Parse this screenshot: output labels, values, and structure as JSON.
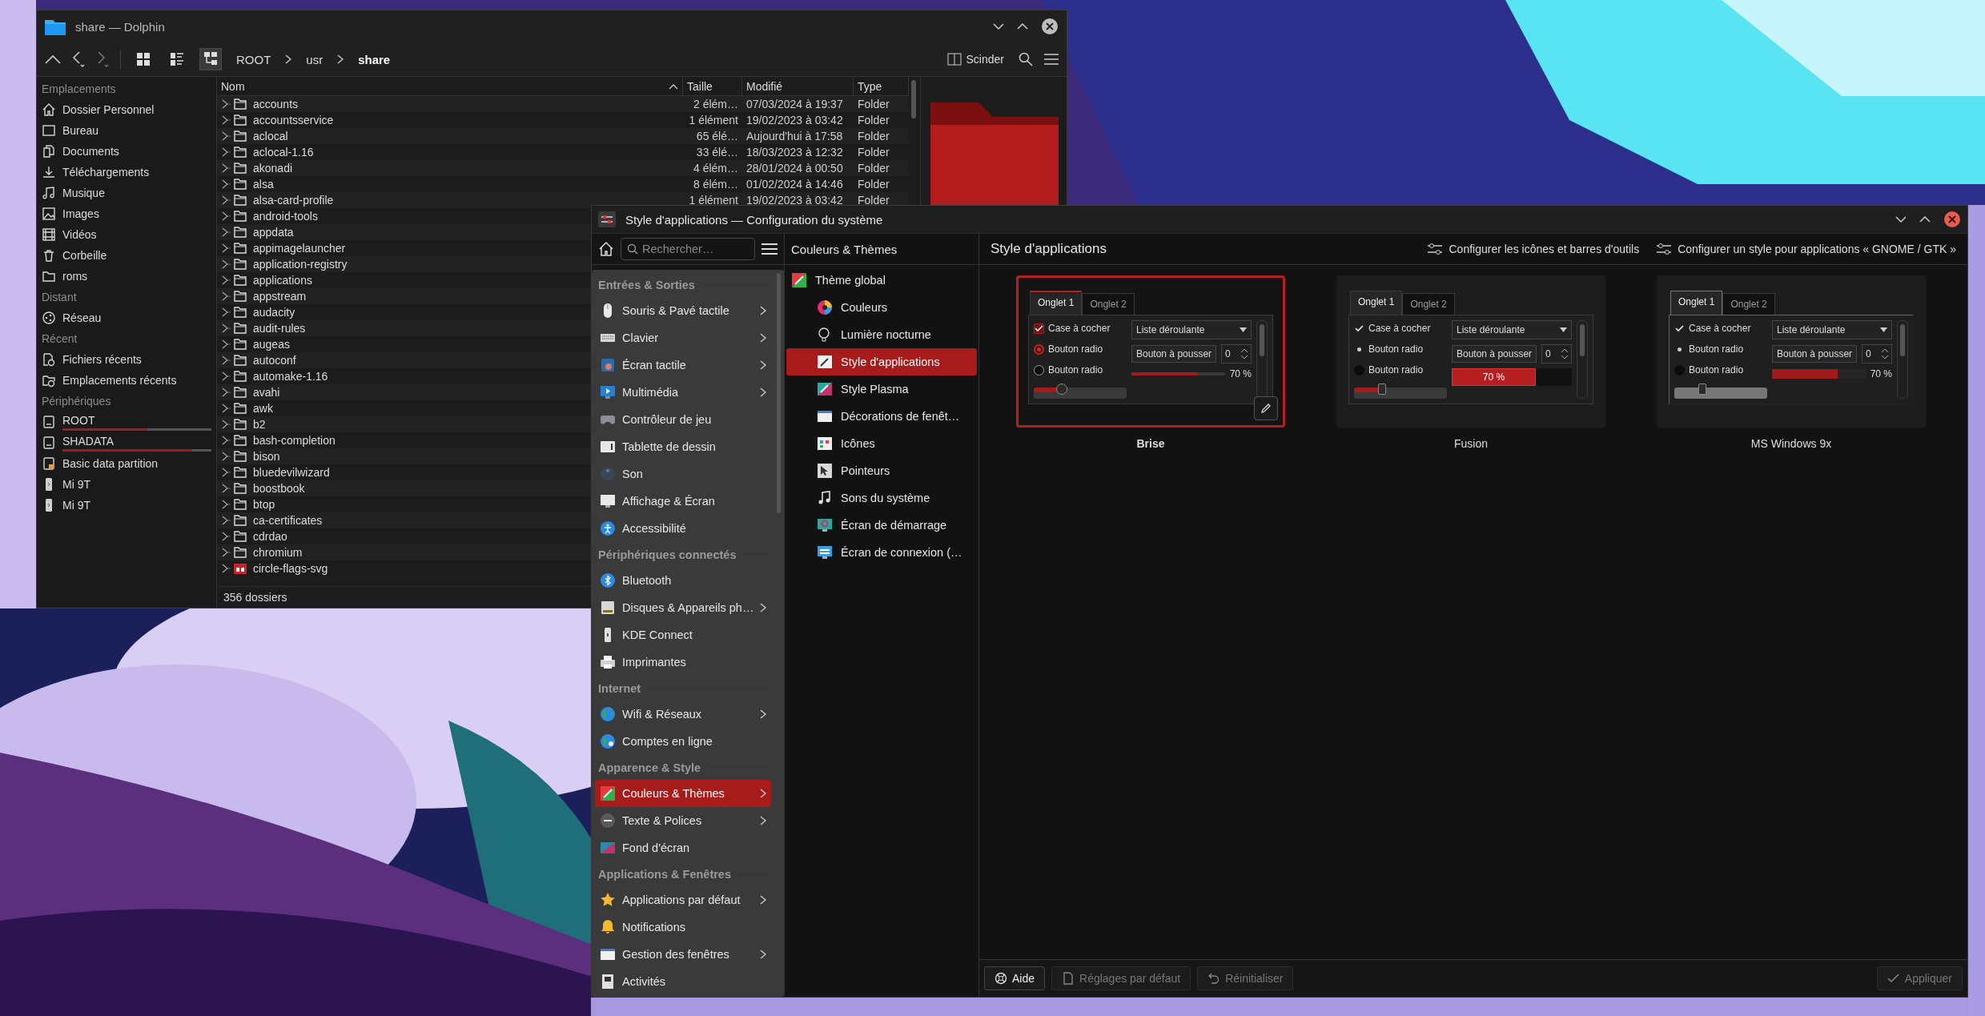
{
  "dolphin": {
    "title": "share — Dolphin",
    "view_modes": [
      {
        "selected": false
      },
      {
        "selected": false
      },
      {
        "selected": true
      }
    ],
    "breadcrumb": [
      {
        "label": "ROOT",
        "current": false
      },
      {
        "label": "usr",
        "current": false
      },
      {
        "label": "share",
        "current": true
      }
    ],
    "split_button": "Scinder",
    "places": [
      {
        "heading": "Emplacements",
        "items": [
          {
            "label": "Dossier Personnel"
          },
          {
            "label": "Bureau"
          },
          {
            "label": "Documents"
          },
          {
            "label": "Téléchargements"
          },
          {
            "label": "Musique"
          },
          {
            "label": "Images"
          },
          {
            "label": "Vidéos"
          },
          {
            "label": "Corbeille"
          },
          {
            "label": "roms"
          }
        ]
      },
      {
        "heading": "Distant",
        "items": [
          {
            "label": "Réseau"
          }
        ]
      },
      {
        "heading": "Récent",
        "items": [
          {
            "label": "Fichiers récents"
          },
          {
            "label": "Emplacements récents"
          }
        ]
      },
      {
        "heading": "Périphériques",
        "items": [
          {
            "label": "ROOT",
            "level": 0.57
          },
          {
            "label": "SHADATA",
            "level": 0.87
          },
          {
            "label": "Basic data partition"
          },
          {
            "label": "Mi 9T"
          },
          {
            "label": "Mi 9T"
          }
        ]
      }
    ],
    "columns": [
      "Nom",
      "Taille",
      "Modifié",
      "Type"
    ],
    "rows": [
      {
        "name": "accounts",
        "kind": "folder",
        "size": "2 élém…",
        "modified": "07/03/2024 à 19:37",
        "type": "Folder"
      },
      {
        "name": "accountsservice",
        "kind": "folder",
        "size": "1 élément",
        "modified": "19/02/2023 à 03:42",
        "type": "Folder"
      },
      {
        "name": "aclocal",
        "kind": "folder",
        "size": "65 élé…",
        "modified": "Aujourd'hui à 17:58",
        "type": "Folder"
      },
      {
        "name": "aclocal-1.16",
        "kind": "folder",
        "size": "33 élé…",
        "modified": "18/03/2023 à 12:32",
        "type": "Folder"
      },
      {
        "name": "akonadi",
        "kind": "folder",
        "size": "4 élém…",
        "modified": "28/01/2024 à 00:50",
        "type": "Folder"
      },
      {
        "name": "alsa",
        "kind": "folder",
        "size": "8 élém…",
        "modified": "01/02/2024 à 14:46",
        "type": "Folder"
      },
      {
        "name": "alsa-card-profile",
        "kind": "folder",
        "size": "1 élément",
        "modified": "19/02/2023 à 03:42",
        "type": "Folder"
      },
      {
        "name": "android-tools",
        "kind": "folder"
      },
      {
        "name": "appdata",
        "kind": "folder"
      },
      {
        "name": "appimagelauncher",
        "kind": "folder"
      },
      {
        "name": "application-registry",
        "kind": "folder"
      },
      {
        "name": "applications",
        "kind": "folder"
      },
      {
        "name": "appstream",
        "kind": "folder"
      },
      {
        "name": "audacity",
        "kind": "folder"
      },
      {
        "name": "audit-rules",
        "kind": "folder"
      },
      {
        "name": "augeas",
        "kind": "folder"
      },
      {
        "name": "autoconf",
        "kind": "folder"
      },
      {
        "name": "automake-1.16",
        "kind": "folder"
      },
      {
        "name": "avahi",
        "kind": "folder"
      },
      {
        "name": "awk",
        "kind": "folder"
      },
      {
        "name": "b2",
        "kind": "folder"
      },
      {
        "name": "bash-completion",
        "kind": "folder"
      },
      {
        "name": "bison",
        "kind": "folder"
      },
      {
        "name": "bluedevilwizard",
        "kind": "folder"
      },
      {
        "name": "boostbook",
        "kind": "folder"
      },
      {
        "name": "btop",
        "kind": "folder"
      },
      {
        "name": "ca-certificates",
        "kind": "folder"
      },
      {
        "name": "cdrdao",
        "kind": "folder"
      },
      {
        "name": "chromium",
        "kind": "folder"
      },
      {
        "name": "circle-flags-svg",
        "kind": "flag-folder"
      }
    ],
    "status": "356 dossiers"
  },
  "settings": {
    "title": "Style d'applications — Configuration du système",
    "search": {
      "placeholder": "Rechercher…"
    },
    "sidebar": [
      {
        "heading": "Entrées & Sorties",
        "items": [
          {
            "label": "Souris & Pavé tactile",
            "has_submenu": true,
            "selected": false
          },
          {
            "label": "Clavier",
            "has_submenu": true,
            "selected": false
          },
          {
            "label": "Écran tactile",
            "has_submenu": true,
            "selected": false
          },
          {
            "label": "Multimédia",
            "has_submenu": true,
            "selected": false
          },
          {
            "label": "Contrôleur de jeu",
            "has_submenu": false,
            "selected": false
          },
          {
            "label": "Tablette de dessin",
            "has_submenu": false,
            "selected": false
          },
          {
            "label": "Son",
            "has_submenu": false,
            "selected": false
          },
          {
            "label": "Affichage & Écran",
            "has_submenu": false,
            "selected": false
          },
          {
            "label": "Accessibilité",
            "has_submenu": false,
            "selected": false
          }
        ]
      },
      {
        "heading": "Périphériques connectés",
        "items": [
          {
            "label": "Bluetooth",
            "has_submenu": false,
            "selected": false
          },
          {
            "label": "Disques & Appareils ph…",
            "has_submenu": true,
            "selected": false
          },
          {
            "label": "KDE Connect",
            "has_submenu": false,
            "selected": false
          },
          {
            "label": "Imprimantes",
            "has_submenu": false,
            "selected": false
          }
        ]
      },
      {
        "heading": "Internet",
        "items": [
          {
            "label": "Wifi & Réseaux",
            "has_submenu": true,
            "selected": false
          },
          {
            "label": "Comptes en ligne",
            "has_submenu": false,
            "selected": false
          }
        ]
      },
      {
        "heading": "Apparence & Style",
        "items": [
          {
            "label": "Couleurs & Thèmes",
            "has_submenu": true,
            "selected": true
          },
          {
            "label": "Texte & Polices",
            "has_submenu": true,
            "selected": false
          },
          {
            "label": "Fond d'écran",
            "has_submenu": false,
            "selected": false
          }
        ]
      },
      {
        "heading": "Applications & Fenêtres",
        "items": [
          {
            "label": "Applications par défaut",
            "has_submenu": true,
            "selected": false
          },
          {
            "label": "Notifications",
            "has_submenu": false,
            "selected": false
          },
          {
            "label": "Gestion des fenêtres",
            "has_submenu": true,
            "selected": false
          },
          {
            "label": "Activités",
            "has_submenu": false,
            "selected": false
          }
        ]
      }
    ],
    "category": {
      "title": "Couleurs & Thèmes",
      "items": [
        {
          "label": "Thème global",
          "selected": false,
          "children": [
            {
              "label": "Couleurs",
              "selected": false
            },
            {
              "label": "Lumière nocturne",
              "selected": false
            },
            {
              "label": "Style d'applications",
              "selected": true
            },
            {
              "label": "Style Plasma",
              "selected": false
            },
            {
              "label": "Décorations de fenêt…",
              "selected": false
            },
            {
              "label": "Icônes",
              "selected": false
            },
            {
              "label": "Pointeurs",
              "selected": false
            },
            {
              "label": "Sons du système",
              "selected": false
            },
            {
              "label": "Écran de démarrage",
              "selected": false
            },
            {
              "label": "Écran de connexion (…",
              "selected": false
            }
          ]
        }
      ]
    },
    "page": {
      "title": "Style d'applications",
      "actions": [
        "Configurer les icônes et barres d'outils",
        "Configurer un style pour applications « GNOME / GTK »"
      ],
      "styles": [
        {
          "name": "Brise",
          "kind": "brise",
          "selected": true,
          "tabs": [
            {
              "label": "Onglet 1",
              "selected": true
            },
            {
              "label": "Onglet 2",
              "selected": false
            }
          ],
          "checkbox": {
            "label": "Case à cocher",
            "checked": true
          },
          "radios": [
            {
              "label": "Bouton radio",
              "selected": true
            },
            {
              "label": "Bouton radio",
              "selected": false
            }
          ],
          "slider": {
            "level": 0.3
          },
          "combo": "Liste déroulante",
          "button": "Bouton à pousser",
          "spin": "0",
          "progress": {
            "level": 0.7,
            "text": "70 %"
          }
        },
        {
          "name": "Fusion",
          "kind": "fusion",
          "selected": false,
          "tabs": [
            {
              "label": "Onglet 1",
              "selected": true
            },
            {
              "label": "Onglet 2",
              "selected": false
            }
          ],
          "checkbox": {
            "label": "Case à cocher",
            "checked": true
          },
          "radios": [
            {
              "label": "Bouton radio",
              "selected": true
            },
            {
              "label": "Bouton radio",
              "selected": false
            }
          ],
          "slider": {
            "level": 0.3
          },
          "combo": "Liste déroulante",
          "button": "Bouton à pousser",
          "spin": "0",
          "progress": {
            "level": 0.7,
            "text": "70 %"
          }
        },
        {
          "name": "MS Windows 9x",
          "kind": "win9x",
          "selected": false,
          "tabs": [
            {
              "label": "Onglet 1",
              "selected": true
            },
            {
              "label": "Onglet 2",
              "selected": false
            }
          ],
          "checkbox": {
            "label": "Case à cocher",
            "checked": true
          },
          "radios": [
            {
              "label": "Bouton radio",
              "selected": true
            },
            {
              "label": "Bouton radio",
              "selected": false
            }
          ],
          "slider": {
            "level": 0.3
          },
          "combo": "Liste déroulante",
          "button": "Bouton à pousser",
          "spin": "0",
          "progress": {
            "level": 0.7,
            "text": "70 %"
          }
        }
      ]
    },
    "footer": [
      {
        "label": "Aide",
        "disabled": false
      },
      {
        "label": "Réglages par défaut",
        "disabled": true
      },
      {
        "label": "Réinitialiser",
        "disabled": true
      },
      {
        "label": "Appliquer",
        "disabled": true
      }
    ]
  }
}
